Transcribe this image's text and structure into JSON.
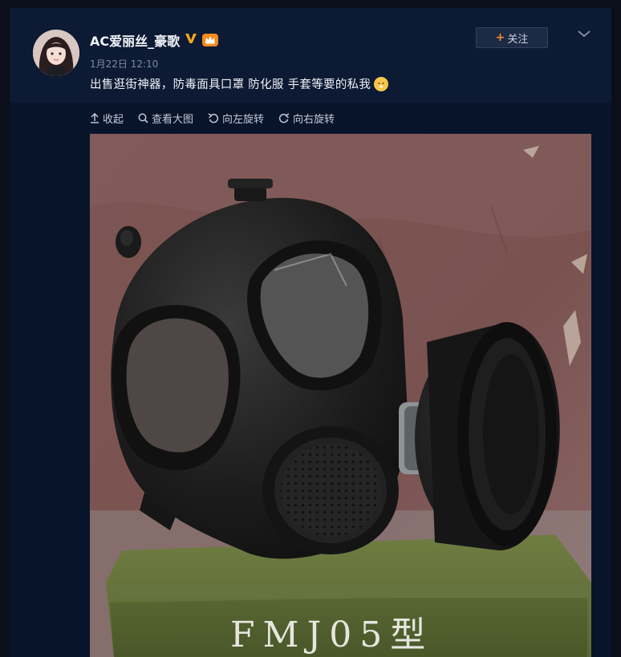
{
  "post": {
    "author": "AC爱丽丝_豪歌",
    "timestamp": "1月22日 12:10",
    "text": "出售逛街神器，防毒面具口罩 防化服 手套等要的私我",
    "follow_label": "关注"
  },
  "toolbar": {
    "collapse_label": "收起",
    "view_large_label": "查看大图",
    "rotate_left_label": "向左旋转",
    "rotate_right_label": "向右旋转"
  },
  "image": {
    "crate_text": "FMJ05型"
  },
  "icons": [
    "verified-v-icon",
    "vip-crown-icon",
    "plus-icon",
    "chevron-down-icon",
    "collapse-arrow-icon",
    "magnifier-icon",
    "rotate-left-icon",
    "rotate-right-icon",
    "emoji-icon"
  ],
  "colors": {
    "background": "#0c1a33",
    "expanded_background": "#08142a",
    "verified": "#f5a623",
    "follow_plus": "#ff8a33",
    "text": "#eef1f6",
    "muted": "#7f8aa2"
  }
}
